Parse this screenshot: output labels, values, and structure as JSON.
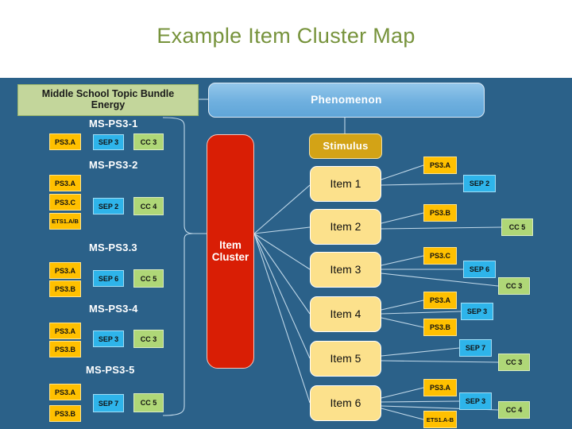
{
  "title": "Example Item Cluster Map",
  "colors": {
    "background": "#2B6189",
    "title": "#77933C",
    "bundle": "#C3D69B",
    "phenomenon": "#6FB0DF",
    "stimulus": "#D3A316",
    "cluster": "#D91E05",
    "item": "#FCE18C",
    "dci": "#FFC000",
    "sep": "#2EB4EA",
    "ccc": "#AFD777",
    "connector": "#BFD7E8"
  },
  "diagram": {
    "bundle": {
      "line1": "Middle School Topic Bundle",
      "line2": "Energy"
    },
    "phenomenon": "Phenomenon",
    "stimulus": "Stimulus",
    "cluster": {
      "line1": "Item",
      "line2": "Cluster"
    },
    "performance_expectations": [
      {
        "label": "MS-PS3-1",
        "dci": [
          "PS3.A"
        ],
        "sep": [
          "SEP 3"
        ],
        "ccc": [
          "CC 3"
        ]
      },
      {
        "label": "MS-PS3-2",
        "dci": [
          "PS3.A",
          "PS3.C",
          "ETS1.A/B"
        ],
        "sep": [
          "SEP 2"
        ],
        "ccc": [
          "CC 4"
        ]
      },
      {
        "label": "MS-PS3.3",
        "dci": [
          "PS3.A",
          "PS3.B"
        ],
        "sep": [
          "SEP 6"
        ],
        "ccc": [
          "CC 5"
        ]
      },
      {
        "label": "MS-PS3-4",
        "dci": [
          "PS3.A",
          "PS3.B"
        ],
        "sep": [
          "SEP 3"
        ],
        "ccc": [
          "CC 3"
        ]
      },
      {
        "label": "MS-PS3-5",
        "dci": [
          "PS3.A",
          "PS3.B"
        ],
        "sep": [
          "SEP 7"
        ],
        "ccc": [
          "CC 5"
        ]
      }
    ],
    "items": [
      {
        "label": "Item 1",
        "tags": [
          "PS3.A",
          "SEP 2"
        ]
      },
      {
        "label": "Item 2",
        "tags": [
          "PS3.B",
          "CC 5"
        ]
      },
      {
        "label": "Item 3",
        "tags": [
          "PS3.C",
          "SEP 6",
          "CC 3"
        ]
      },
      {
        "label": "Item 4",
        "tags": [
          "PS3.A",
          "SEP 3",
          "PS3.B"
        ]
      },
      {
        "label": "Item 5",
        "tags": [
          "SEP 7",
          "CC 3"
        ]
      },
      {
        "label": "Item 6",
        "tags": [
          "PS3.A",
          "SEP 3",
          "ETS1.A-B",
          "CC 4"
        ]
      }
    ]
  }
}
